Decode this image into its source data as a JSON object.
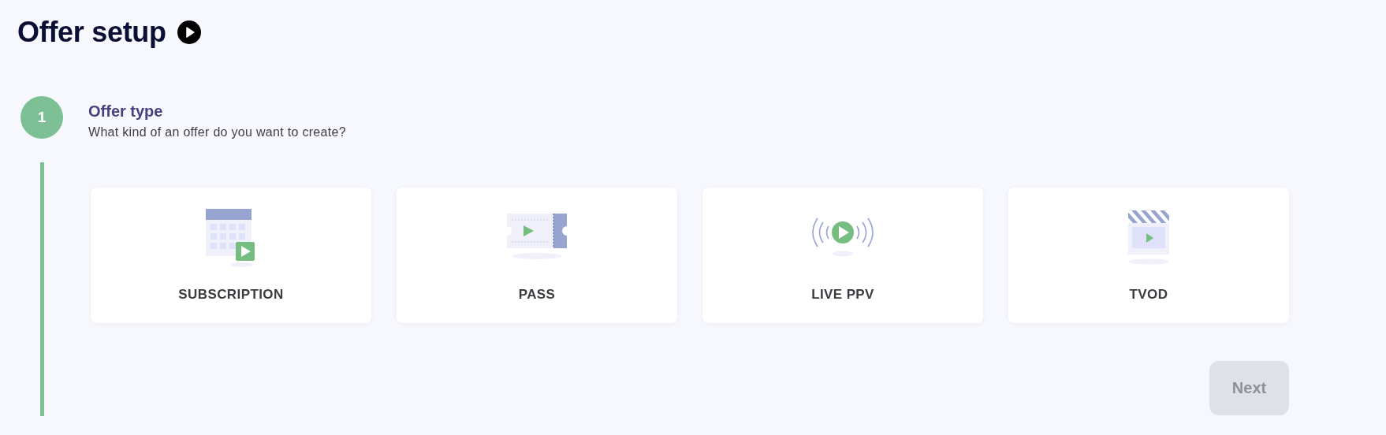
{
  "page": {
    "title": "Offer setup"
  },
  "step": {
    "number": "1",
    "title": "Offer type",
    "subtitle": "What kind of an offer do you want to create?"
  },
  "offer_types": [
    {
      "kind": "subscription",
      "label": "SUBSCRIPTION"
    },
    {
      "kind": "pass",
      "label": "PASS"
    },
    {
      "kind": "live",
      "label": "LIVE PPV"
    },
    {
      "kind": "tvod",
      "label": "TVOD"
    }
  ],
  "next_button": {
    "label": "Next",
    "disabled": true
  }
}
